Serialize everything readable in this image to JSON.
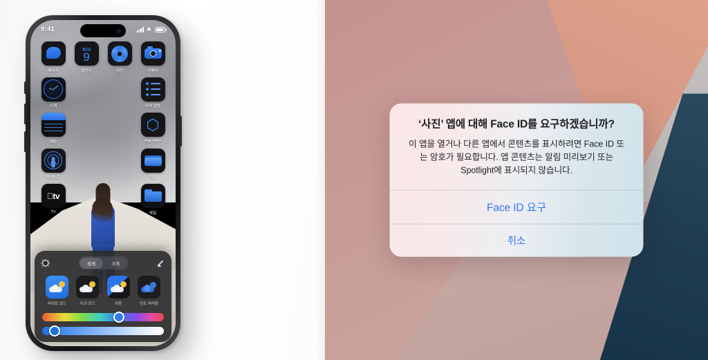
{
  "phone": {
    "status_bar": {
      "time": "9:41",
      "signal_icon": "cellular-signal-icon",
      "wifi_icon": "wifi-icon",
      "battery_icon": "battery-icon"
    },
    "home_screen": {
      "rows": [
        [
          {
            "label": "메시지",
            "icon": "messages-icon"
          },
          {
            "label": "캘린더",
            "icon": "calendar-icon",
            "weekday": "월요일",
            "day": "9"
          },
          {
            "label": "사진",
            "icon": "photos-icon"
          },
          {
            "label": "카메라",
            "icon": "camera-icon"
          }
        ],
        [
          {
            "label": "시계",
            "icon": "clock-icon"
          },
          {
            "label": "",
            "icon": ""
          },
          {
            "label": "",
            "icon": ""
          },
          {
            "label": "미리 알림",
            "icon": "reminders-icon"
          }
        ],
        [
          {
            "label": "메모",
            "icon": "notes-icon"
          },
          {
            "label": "",
            "icon": ""
          },
          {
            "label": "",
            "icon": ""
          },
          {
            "label": "App Store",
            "icon": "app-store-icon"
          }
        ],
        [
          {
            "label": "팟캐스트",
            "icon": "podcasts-icon"
          },
          {
            "label": "",
            "icon": ""
          },
          {
            "label": "",
            "icon": ""
          },
          {
            "label": "지갑",
            "icon": "wallet-icon"
          }
        ],
        [
          {
            "label": "TV",
            "icon": "apple-tv-icon"
          },
          {
            "label": "",
            "icon": ""
          },
          {
            "label": "",
            "icon": ""
          },
          {
            "label": "파일",
            "icon": "files-icon"
          }
        ]
      ]
    },
    "customize_tray": {
      "brightness_icon": "sun-brightness-icon",
      "eyedropper_icon": "eyedropper-icon",
      "size_segments": [
        {
          "label": "작게",
          "selected": true
        },
        {
          "label": "크게",
          "selected": false
        }
      ],
      "appearance_modes": [
        {
          "label": "라이트 모드",
          "selected": false
        },
        {
          "label": "다크 모드",
          "selected": false
        },
        {
          "label": "자동",
          "selected": false
        },
        {
          "label": "틴트 처리됨",
          "selected": true
        }
      ],
      "hue_slider": {
        "name": "hue-slider",
        "value_pct": 63
      },
      "saturation_slider": {
        "name": "saturation-slider",
        "value_pct": 10
      }
    }
  },
  "alert": {
    "title": "‘사진’ 앱에 대해 Face ID를 요구하겠습니까?",
    "message": "이 앱을 열거나 다른 앱에서 콘텐츠를 표시하려면 Face ID 또는 암호가 필요합니다. 앱 콘텐츠는 알림 미리보기 또는 Spotlight에 표시되지 않습니다.",
    "primary_button": "Face ID 요구",
    "cancel_button": "취소",
    "accent_color": "#3478f6"
  }
}
